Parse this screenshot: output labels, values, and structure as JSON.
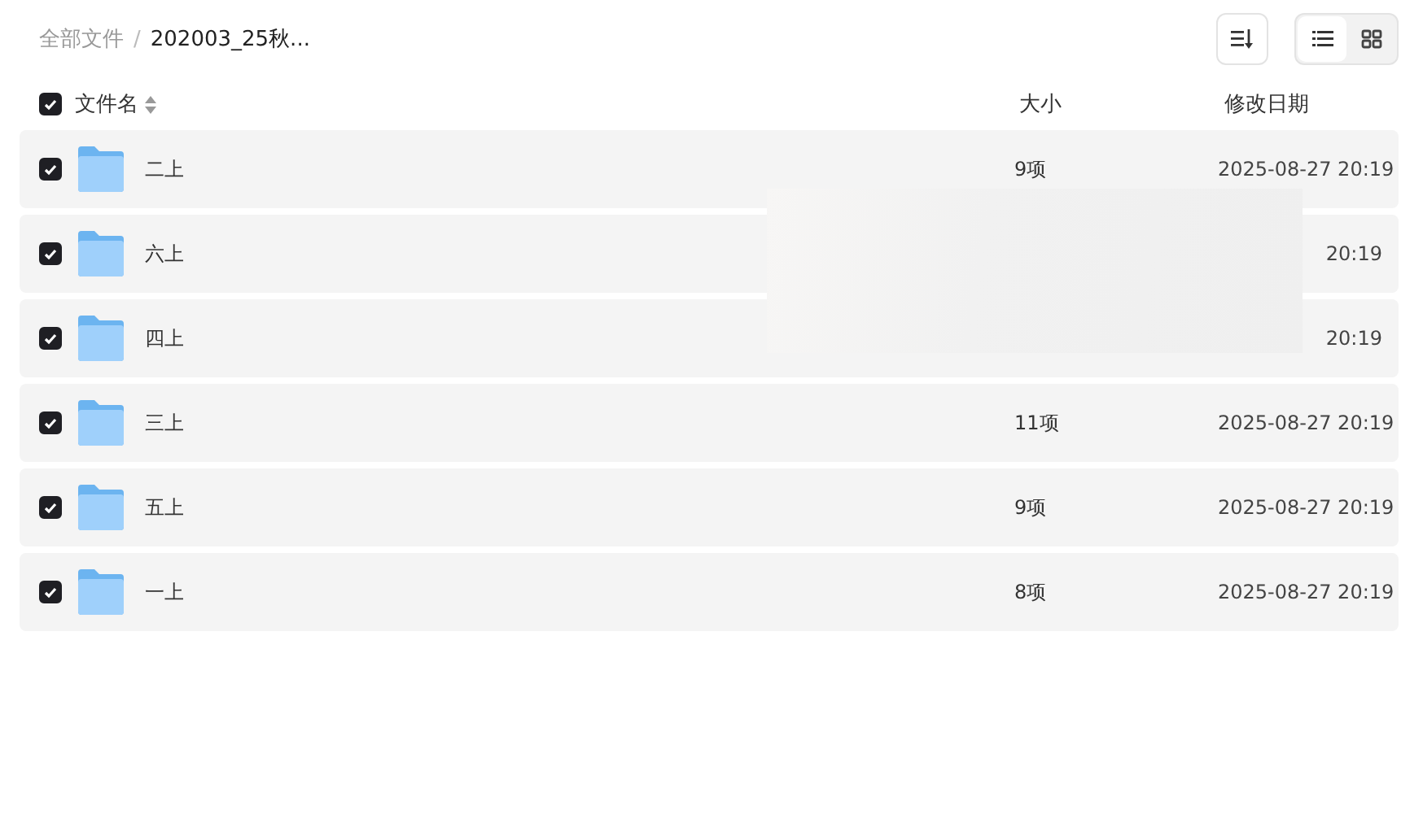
{
  "breadcrumb": [
    {
      "label": "全部文件",
      "current": false
    },
    {
      "label": "202003_25秋...",
      "current": true
    }
  ],
  "breadcrumb_separator": "/",
  "toolbar": {
    "views": [
      {
        "kind": "list",
        "selected": true
      },
      {
        "kind": "grid",
        "selected": false
      }
    ]
  },
  "table": {
    "select_all": {
      "checked": true
    },
    "columns": [
      {
        "label": "文件名",
        "kind": "sortable"
      },
      {
        "label": "大小",
        "kind": "plain"
      },
      {
        "label": "修改日期",
        "kind": "plain"
      }
    ],
    "rows": [
      {
        "name": "二上",
        "size": "9项",
        "date": "2025-08-27 20:19",
        "checked": true
      },
      {
        "name": "六上",
        "date": "20:19",
        "checked": true
      },
      {
        "name": "四上",
        "date": "20:19",
        "checked": true
      },
      {
        "name": "三上",
        "size": "11项",
        "date": "2025-08-27 20:19",
        "checked": true
      },
      {
        "name": "五上",
        "size": "9项",
        "date": "2025-08-27 20:19",
        "checked": true
      },
      {
        "name": "一上",
        "size": "8项",
        "date": "2025-08-27 20:19",
        "checked": true
      }
    ]
  }
}
